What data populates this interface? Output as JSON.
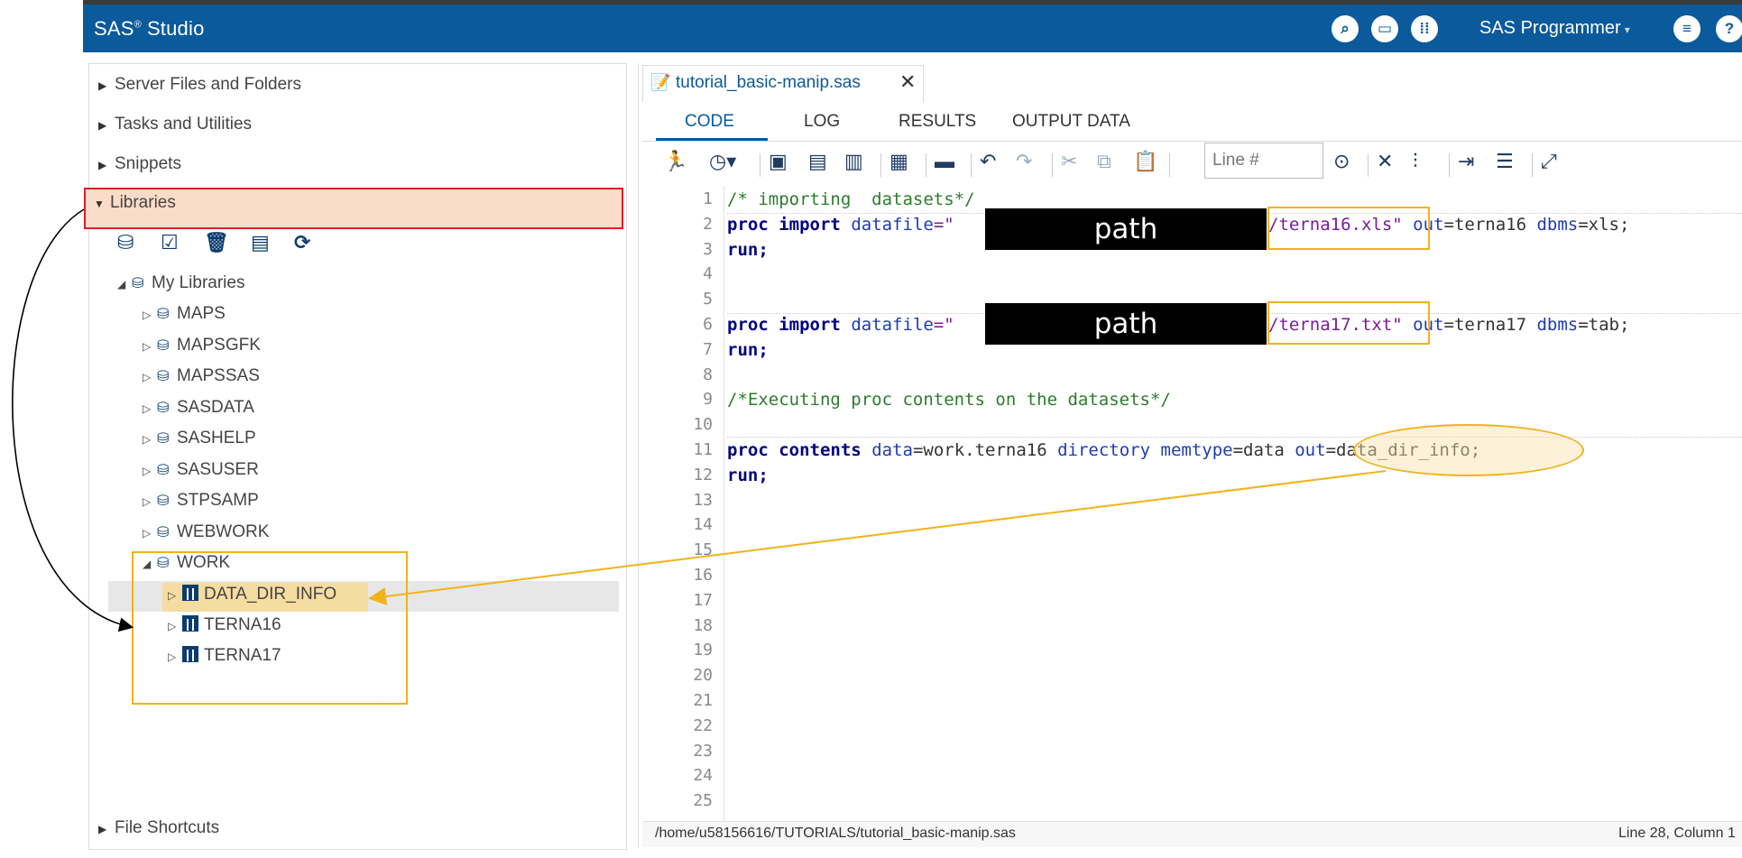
{
  "app": {
    "brand": "SAS",
    "reg": "®",
    "product": "Studio",
    "user": "SAS Programmer",
    "user_caret": "▾"
  },
  "appbar_icons": [
    "search-icon",
    "folder-icon",
    "apps-icon",
    "menu-icon",
    "help-icon"
  ],
  "navigator": {
    "sections": {
      "server_files": "Server Files and Folders",
      "tasks": "Tasks and Utilities",
      "snippets": "Snippets",
      "libraries": "Libraries",
      "file_shortcuts": "File Shortcuts"
    },
    "lib_tools": [
      "new-library-icon",
      "library-properties-icon",
      "delete-icon",
      "table-icon",
      "refresh-icon"
    ],
    "my_libraries": "My Libraries",
    "libraries": [
      "MAPS",
      "MAPSGFK",
      "MAPSSAS",
      "SASDATA",
      "SASHELP",
      "SASUSER",
      "STPSAMP",
      "WEBWORK",
      "WORK"
    ],
    "work_tables": [
      "DATA_DIR_INFO",
      "TERNA16",
      "TERNA17"
    ]
  },
  "editor": {
    "tab_name": "tutorial_basic-manip.sas",
    "tab_close": "✕",
    "subtabs": [
      "CODE",
      "LOG",
      "RESULTS",
      "OUTPUT DATA"
    ],
    "line_input_placeholder": "Line #",
    "line_numbers": [
      "1",
      "2",
      "3",
      "4",
      "5",
      "6",
      "7",
      "8",
      "9",
      "10",
      "11",
      "12",
      "13",
      "14",
      "15",
      "16",
      "17",
      "18",
      "19",
      "20",
      "21",
      "22",
      "23",
      "24",
      "25"
    ],
    "code": {
      "l1": "/* importing  datasets*/",
      "l2a_kw1": "proc",
      "l2a_kw2": "import",
      "l2a_attr": "datafile",
      "l2a_eq": "=\"",
      "l2b_str": "/terna16.xls\"",
      "l2c_attr1": "out",
      "l2c_val1": "=terna16 ",
      "l2c_attr2": "dbms",
      "l2c_val2": "=xls;",
      "l3": "run;",
      "l6a_kw1": "proc",
      "l6a_kw2": "import",
      "l6a_attr": "datafile",
      "l6a_eq": "=\"",
      "l6b_str": "/terna17.txt\"",
      "l6c_attr1": "out",
      "l6c_val1": "=terna17 ",
      "l6c_attr2": "dbms",
      "l6c_val2": "=tab;",
      "l7": "run;",
      "l9": "/*Executing proc contents on the datasets*/",
      "l11_kw1": "proc",
      "l11_kw2": "contents",
      "l11_attr1": "data",
      "l11_val1": "=work.terna16 ",
      "l11_attr2": "directory",
      "l11_attr3": "memtype",
      "l11_val3": "=data ",
      "l11_attr4": "out",
      "l11_val4": "=data_dir_info;",
      "l12": "run;"
    },
    "redaction_label": "path",
    "status_path": "/home/u58156616/TUTORIALS/tutorial_basic-manip.sas",
    "status_position": "Line 28, Column 1"
  },
  "colors": {
    "appbar": "#0a5a9c",
    "annotation_red": "#e11d2a",
    "annotation_yellow": "#f2b21b",
    "keyword": "#000080",
    "string": "#7a1b9a",
    "comment": "#2b7d2b"
  }
}
